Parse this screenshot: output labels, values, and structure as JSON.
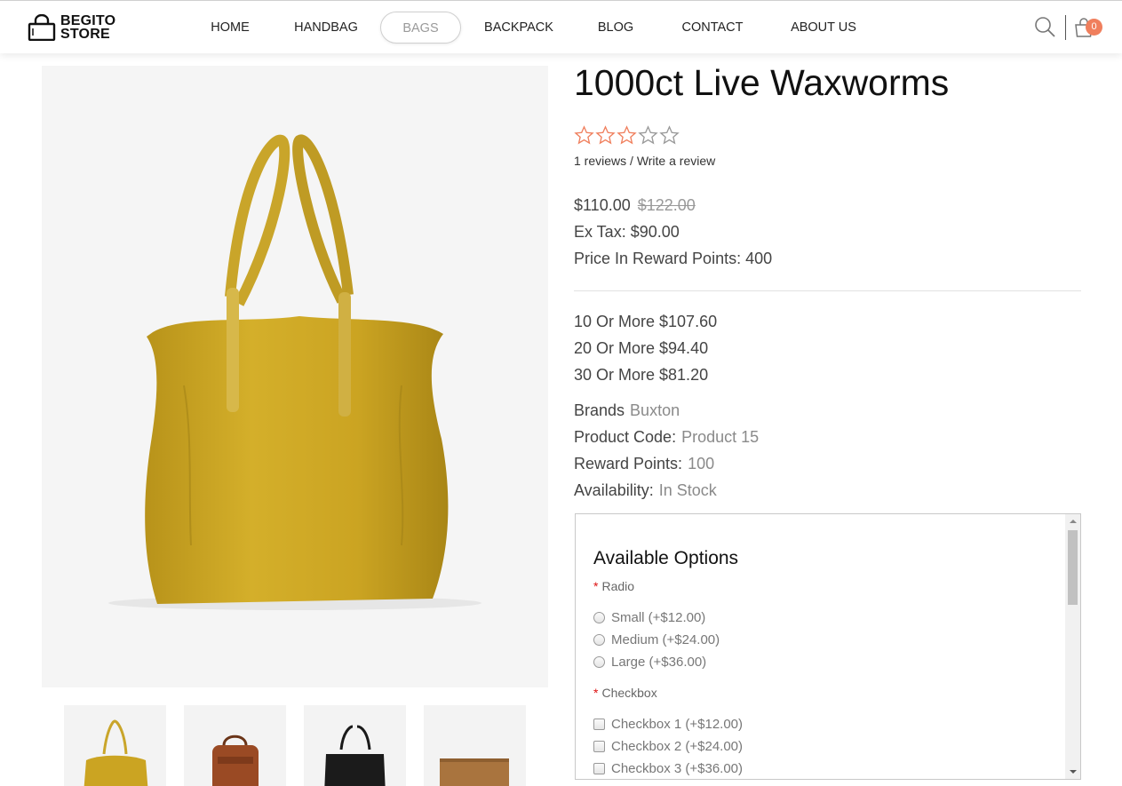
{
  "brand": {
    "line1": "BEGITO",
    "line2": "STORE"
  },
  "nav": [
    {
      "label": "HOME",
      "active": false
    },
    {
      "label": "HANDBAG",
      "active": false
    },
    {
      "label": "BAGS",
      "active": true
    },
    {
      "label": "BACKPACK",
      "active": false
    },
    {
      "label": "BLOG",
      "active": false
    },
    {
      "label": "CONTACT",
      "active": false
    },
    {
      "label": "ABOUT US",
      "active": false
    }
  ],
  "header": {
    "cart_count": "0",
    "search_icon": "search-icon",
    "cart_icon": "shopping-bag-icon"
  },
  "colors": {
    "accent": "#f07f5d",
    "star": "#f07f5d",
    "bag": "#c9a520"
  },
  "product": {
    "title": "1000ct Live Waxworms",
    "rating": 3,
    "rating_max": 5,
    "reviews_count": "1 reviews",
    "review_separator": " / ",
    "write_review": "Write a review",
    "price": "$110.00",
    "price_old": "$122.00",
    "ex_tax": "Ex Tax: $90.00",
    "reward_price": "Price In Reward Points: 400",
    "discounts": [
      "10 Or More $107.60",
      "20 Or More $94.40",
      "30 Or More $81.20"
    ],
    "specs": [
      {
        "label": "Brands",
        "value": "Buxton"
      },
      {
        "label": "Product Code:",
        "value": "Product 15"
      },
      {
        "label": "Reward Points:",
        "value": "100"
      },
      {
        "label": "Availability:",
        "value": "In Stock"
      }
    ]
  },
  "options": {
    "title": "Available Options",
    "required_mark": "*",
    "radio_label": "Radio",
    "radio_items": [
      "Small (+$12.00)",
      "Medium (+$24.00)",
      "Large (+$36.00)"
    ],
    "checkbox_label": "Checkbox",
    "checkbox_items": [
      "Checkbox 1 (+$12.00)",
      "Checkbox 2 (+$24.00)",
      "Checkbox 3 (+$36.00)"
    ]
  },
  "thumbnails": [
    "yellow-tote-thumb",
    "brown-backpack-thumb",
    "black-tote-thumb",
    "tan-clutch-thumb"
  ]
}
